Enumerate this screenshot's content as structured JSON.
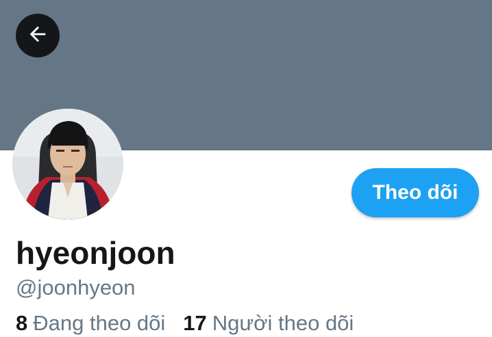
{
  "header": {
    "back_icon": "arrow-left-icon",
    "banner_color": "#657786"
  },
  "profile": {
    "avatar_alt": "avatar",
    "display_name": "hyeonjoon",
    "handle": "@joonhyeon",
    "follow_label": "Theo dõi",
    "accent_color": "#1da1f2"
  },
  "stats": {
    "following": {
      "count": "8",
      "label": "Đang theo dõi"
    },
    "followers": {
      "count": "17",
      "label": "Người theo dõi"
    }
  }
}
